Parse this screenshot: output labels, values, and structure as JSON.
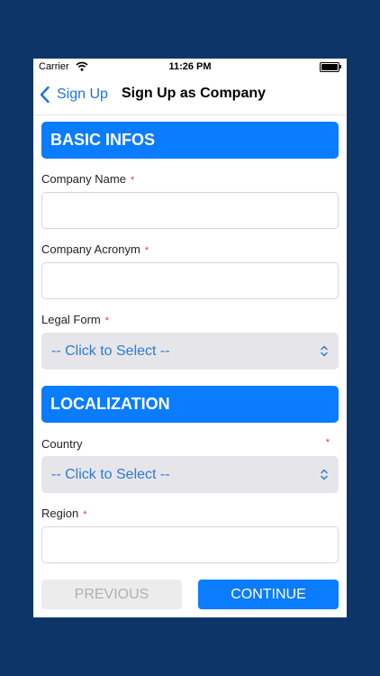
{
  "status_bar": {
    "carrier": "Carrier",
    "time": "11:26 PM"
  },
  "nav": {
    "back_label": "Sign Up",
    "title": "Sign Up as Company"
  },
  "sections": {
    "basic": {
      "title": "BASIC INFOS"
    },
    "localization": {
      "title": "LOCALIZATION"
    }
  },
  "fields": {
    "company_name": {
      "label": "Company Name",
      "required": "*",
      "value": ""
    },
    "company_acronym": {
      "label": "Company Acronym",
      "required": "*",
      "value": ""
    },
    "legal_form": {
      "label": "Legal Form",
      "required": "*",
      "value": "-- Click to Select --"
    },
    "country": {
      "label": "Country",
      "required": "*",
      "value": "-- Click to Select --"
    },
    "region": {
      "label": "Region",
      "required": "*",
      "value": ""
    }
  },
  "buttons": {
    "previous": "PREVIOUS",
    "continue": "CONTINUE"
  },
  "colors": {
    "background": "#0e3568",
    "accent": "#0a7cff",
    "select_text": "#2a7ad6",
    "required": "#e53935"
  }
}
